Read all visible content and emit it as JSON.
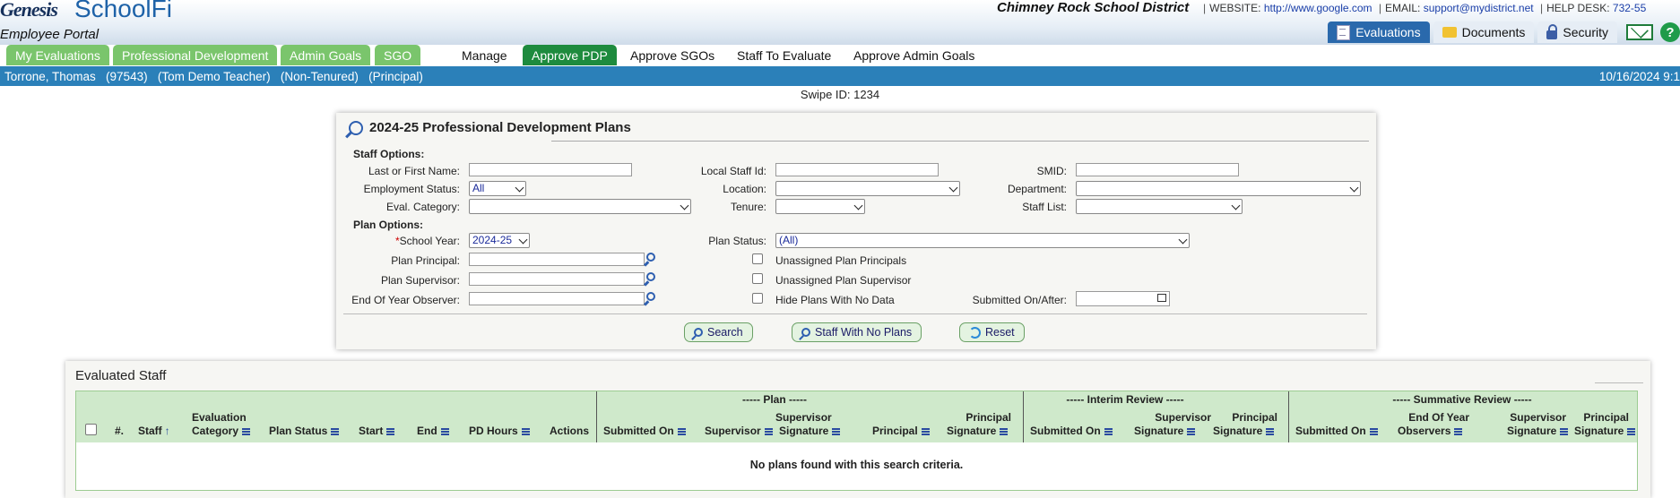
{
  "header": {
    "brand": "Genesis",
    "product": "SchoolFi",
    "portal": "Employee Portal",
    "district": "Chimney Rock School District",
    "website_label": "WEBSITE:",
    "website": "http://www.google.com",
    "email_label": "EMAIL:",
    "email": "support@mydistrict.net",
    "help_label": "HELP DESK:",
    "help_phone": "732-55",
    "top_tabs": [
      {
        "label": "Evaluations",
        "icon": "document-icon",
        "active": true
      },
      {
        "label": "Documents",
        "icon": "folder-icon",
        "active": false
      },
      {
        "label": "Security",
        "icon": "lock-icon",
        "active": false
      }
    ]
  },
  "nav": {
    "green_tabs": [
      "My Evaluations",
      "Professional Development",
      "Admin Goals",
      "SGO"
    ],
    "items": [
      "Manage",
      "Approve PDP",
      "Approve SGOs",
      "Staff To Evaluate",
      "Approve Admin Goals"
    ],
    "active": "Approve PDP"
  },
  "user_bar": {
    "info": "Torrone, Thomas   (97543)   (Tom Demo Teacher)   (Non-Tenured)   (Principal)",
    "date": "10/16/2024 9:1"
  },
  "swipe": "Swipe ID: 1234",
  "search": {
    "title": "2024-25 Professional Development Plans",
    "staff_options": "Staff Options:",
    "plan_options": "Plan Options:",
    "labels": {
      "name": "Last or First Name:",
      "local_id": "Local Staff Id:",
      "smid": "SMID:",
      "employment_status": "Employment Status:",
      "location": "Location:",
      "department": "Department:",
      "eval_category": "Eval. Category:",
      "tenure": "Tenure:",
      "staff_list": "Staff List:",
      "school_year": "School Year:",
      "plan_status": "Plan Status:",
      "plan_principal": "Plan Principal:",
      "plan_supervisor": "Plan Supervisor:",
      "eoy_observer": "End Of Year Observer:",
      "unassigned_principals": "Unassigned Plan Principals",
      "unassigned_supervisor": "Unassigned Plan Supervisor",
      "hide_no_data": "Hide Plans With No Data",
      "submitted_on_after": "Submitted On/After:"
    },
    "required_mark": "*",
    "values": {
      "employment_status": "All",
      "school_year": "2024-25",
      "plan_status": "(All)"
    },
    "buttons": {
      "search": "Search",
      "no_plans": "Staff With No Plans",
      "reset": "Reset"
    }
  },
  "staff_table": {
    "title": "Evaluated Staff",
    "groups": [
      "----- Plan -----",
      "----- Interim Review -----",
      "----- Summative Review -----"
    ],
    "columns": {
      "num": "#.",
      "staff": "Staff",
      "eval_cat_1": "Evaluation",
      "eval_cat_2": "Category",
      "plan_status": "Plan Status",
      "start": "Start",
      "end": "End",
      "pd_hours": "PD Hours",
      "actions": "Actions",
      "submitted_on": "Submitted On",
      "supervisor": "Supervisor",
      "sup_sig_1": "Supervisor",
      "sig": "Signature",
      "principal": "Principal",
      "prin_sig_1": "Principal",
      "eoy_1": "End Of Year",
      "eoy_2": "Observers"
    },
    "empty_message": "No plans found with this search criteria."
  },
  "colors": {
    "brand_blue": "#2a69ac",
    "nav_green": "#7ac56c",
    "active_green": "#1e8b3e",
    "user_bar": "#2b80b9",
    "table_header": "#cfe9cb"
  }
}
